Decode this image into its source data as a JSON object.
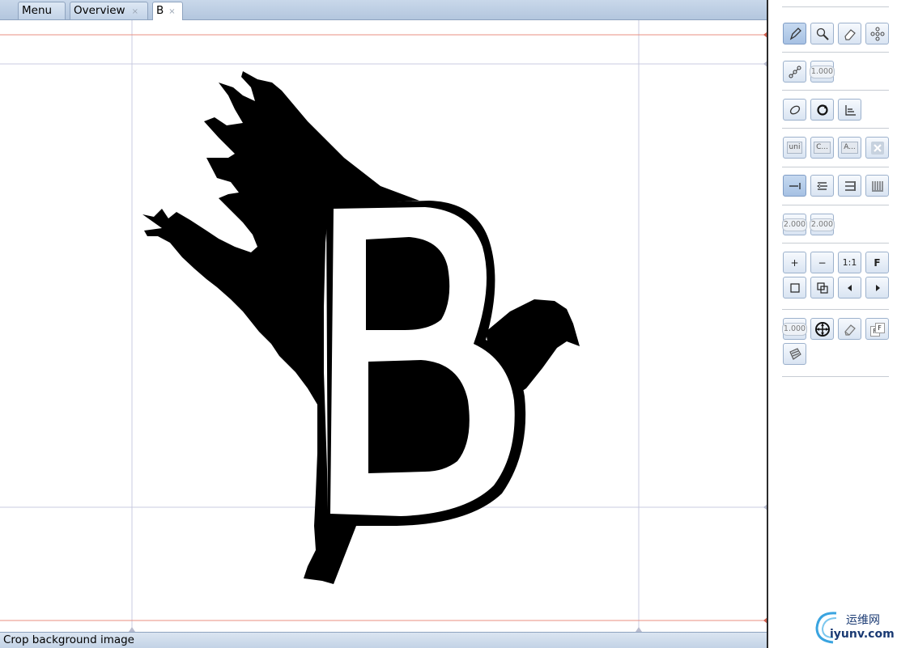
{
  "tabs": {
    "menu_label": "Menu",
    "overview_label": "Overview",
    "glyph_label": "B",
    "close_glyph": "×"
  },
  "status": {
    "text": "Crop background image"
  },
  "toolbar": {
    "value_1000": "1.000",
    "value_2000a": "2.000",
    "value_2000b": "2.000",
    "value_1000b": "1.000",
    "label_uni": "uni",
    "label_c": "C...",
    "label_a": "A...",
    "label_zoom_in": "+",
    "label_zoom_out": "−",
    "label_one_to_one": "1:1",
    "label_fit": "F",
    "label_ff": "F"
  },
  "watermark": {
    "cn": "运维网",
    "en": "iyunv.com"
  },
  "colors": {
    "guide_line": "#c8cbe0",
    "metric_line": "#e88f82",
    "glyph_fill": "#000000",
    "selected_button": "#a6c1e3"
  }
}
